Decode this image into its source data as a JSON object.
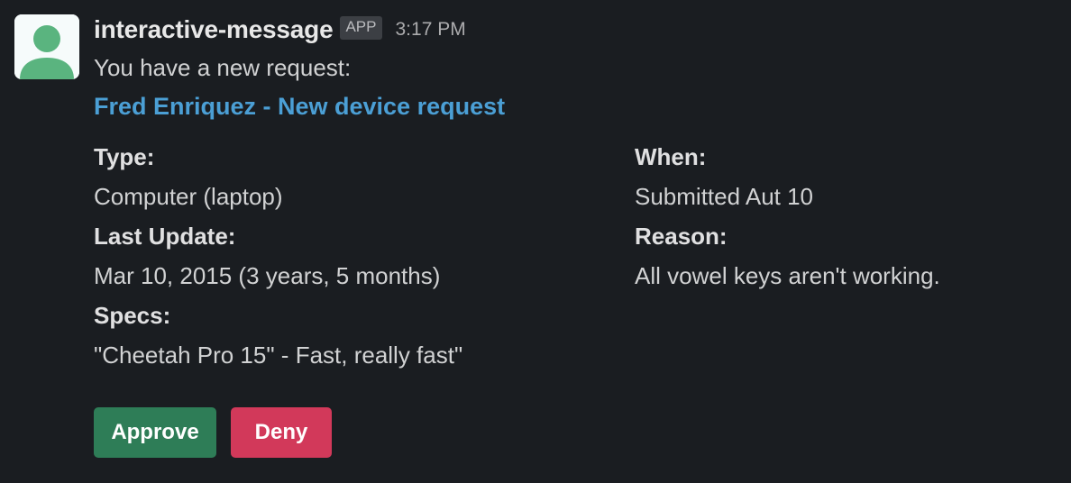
{
  "message": {
    "sender": "interactive-message",
    "badge": "APP",
    "timestamp": "3:17 PM",
    "intro": "You have a new request:",
    "link_text": "Fred Enriquez - New device request"
  },
  "fields": {
    "left": [
      {
        "label": "Type:",
        "value": "Computer (laptop)"
      },
      {
        "label": "Last Update:",
        "value": "Mar 10, 2015 (3 years, 5 months)"
      },
      {
        "label": "Specs:",
        "value": "\"Cheetah Pro 15\" - Fast, really fast\""
      }
    ],
    "right": [
      {
        "label": "When:",
        "value": "Submitted Aut 10"
      },
      {
        "label": "Reason:",
        "value": "All vowel keys aren't working."
      }
    ]
  },
  "actions": {
    "approve_label": "Approve",
    "deny_label": "Deny"
  },
  "colors": {
    "background": "#1a1d21",
    "link": "#4b9fd5",
    "approve": "#2e7d57",
    "deny": "#d2395a",
    "avatar": "#5ab47f"
  },
  "icons": {
    "avatar": "user-avatar-icon"
  }
}
